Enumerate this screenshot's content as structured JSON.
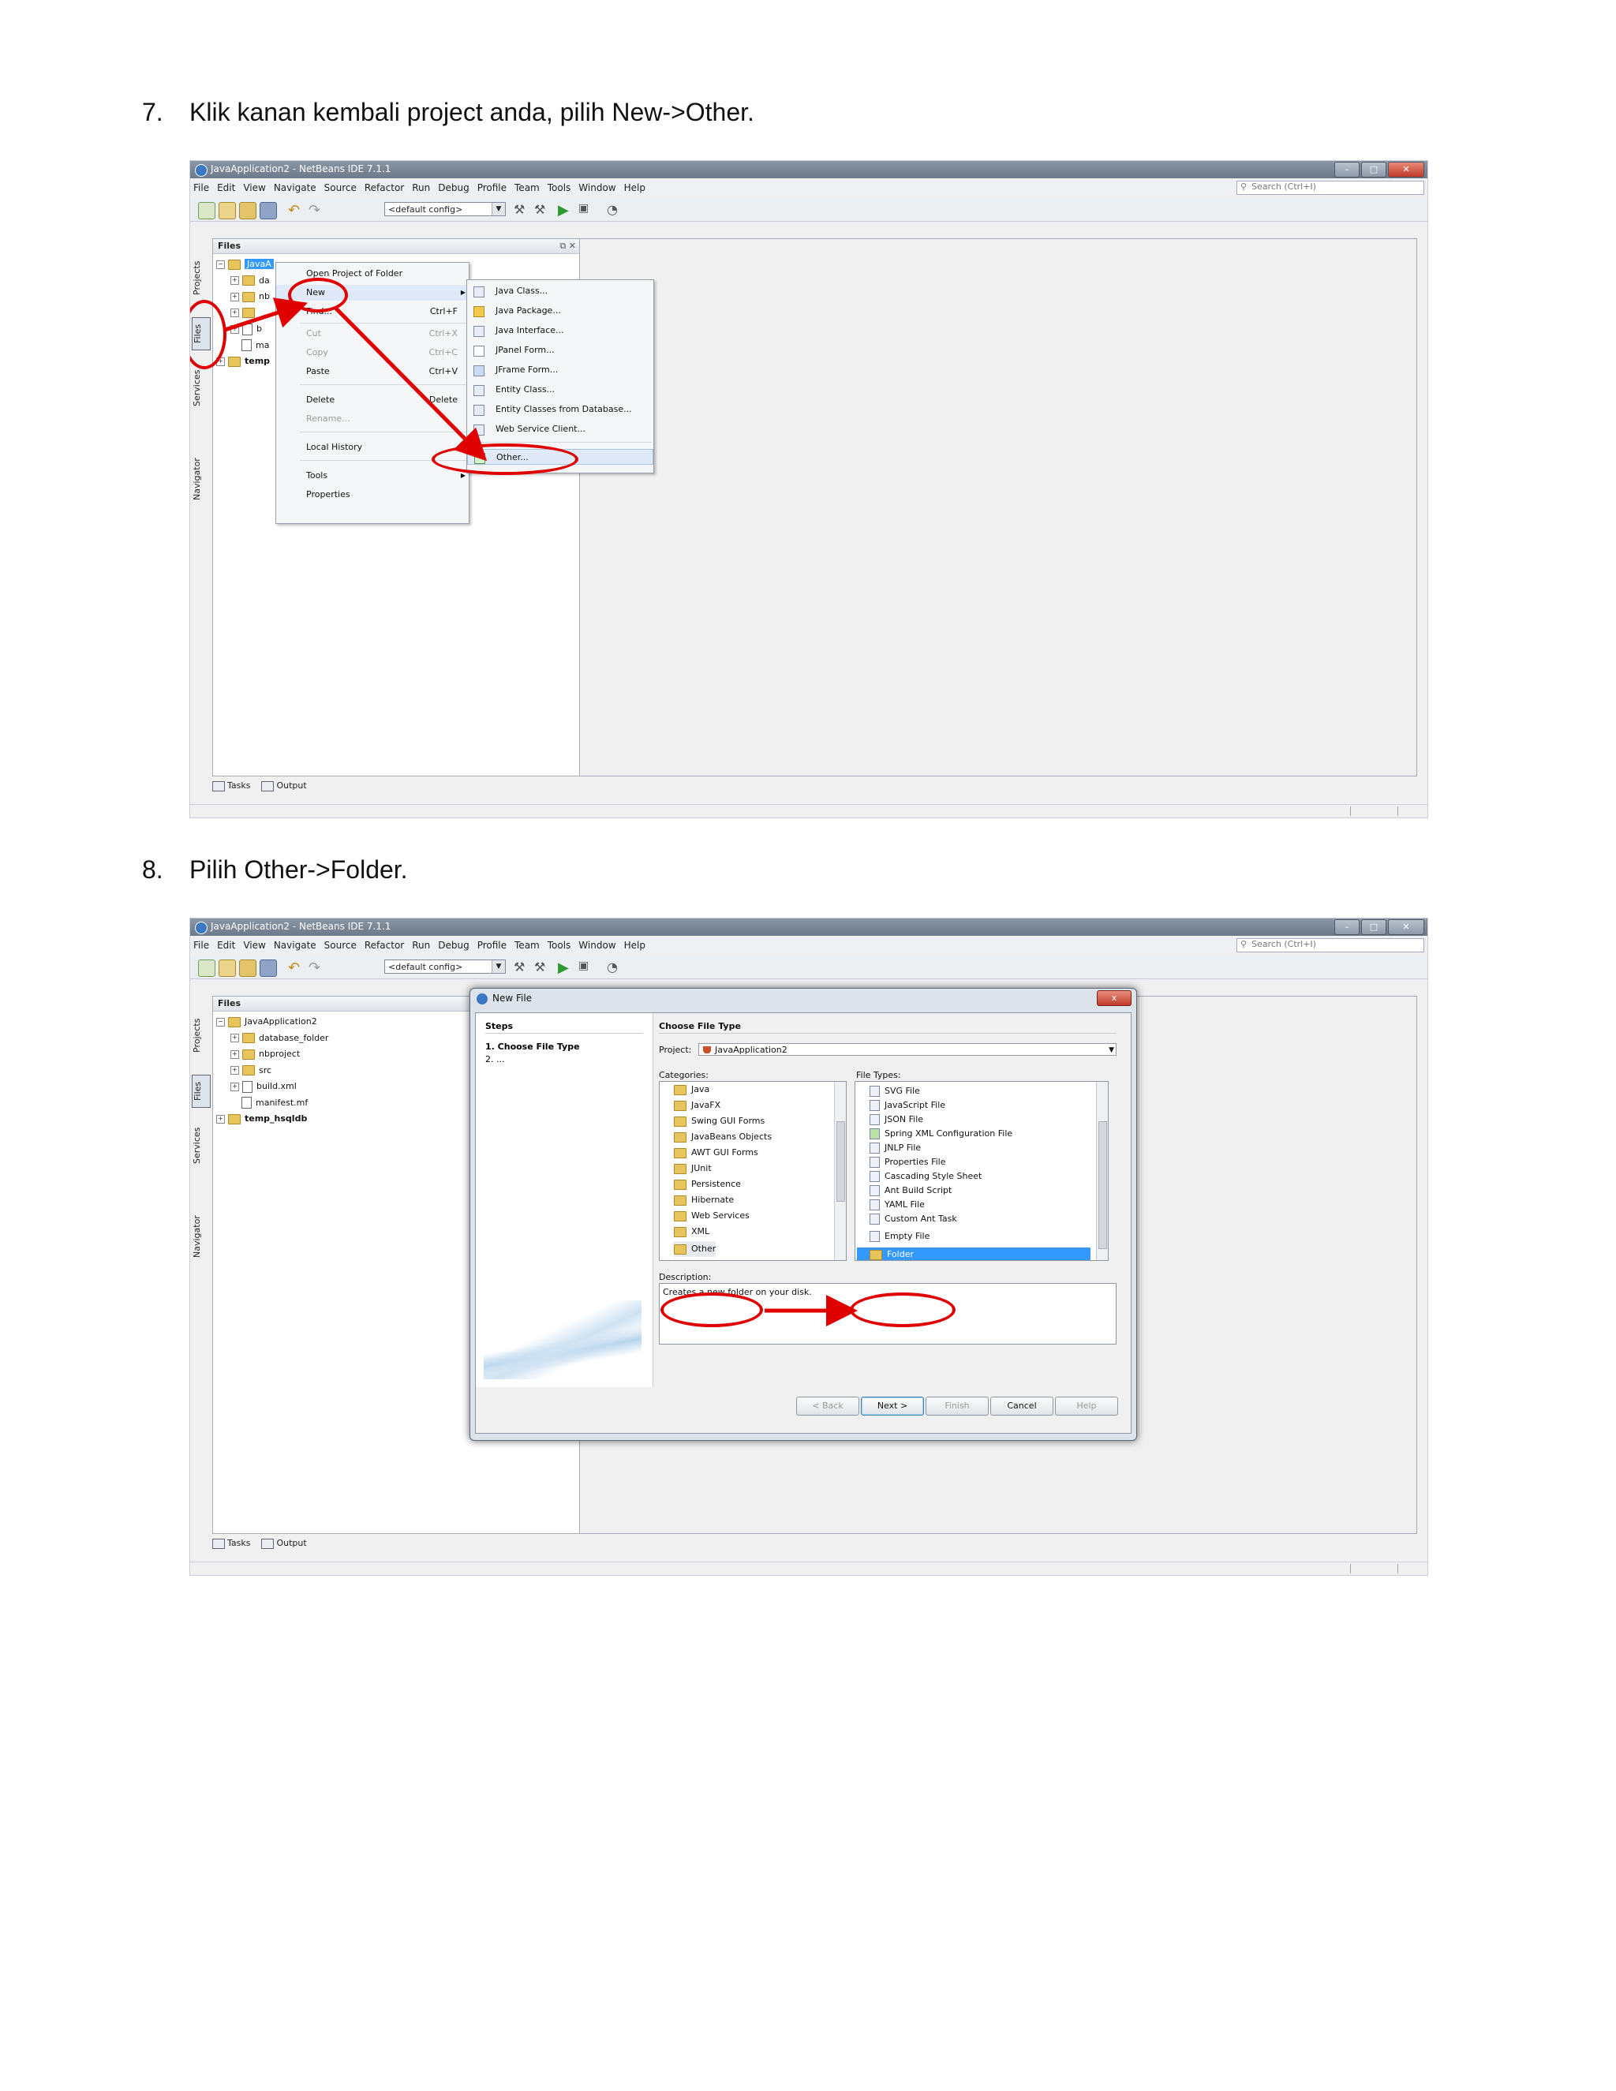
{
  "step7": {
    "number": "7.",
    "text": "Klik kanan kembali project anda, pilih New->Other."
  },
  "step8": {
    "number": "8.",
    "text": "Pilih Other->Folder."
  },
  "ide": {
    "title": "JavaApplication2 - NetBeans IDE 7.1.1",
    "menu": [
      "File",
      "Edit",
      "View",
      "Navigate",
      "Source",
      "Refactor",
      "Run",
      "Debug",
      "Profile",
      "Team",
      "Tools",
      "Window",
      "Help"
    ],
    "search_placeholder": "Search (Ctrl+I)",
    "config": "<default config>",
    "side_tabs": [
      "Projects",
      "Files",
      "Services",
      "Navigator"
    ],
    "panel_title": "Files",
    "bottom_tabs": [
      "Tasks",
      "Output"
    ]
  },
  "shot1": {
    "tree": [
      {
        "toggle": "⊟",
        "label": "JavaA",
        "selected": true
      },
      {
        "toggle": "⊞",
        "label": "da"
      },
      {
        "toggle": "⊞",
        "label": "nb"
      },
      {
        "toggle": "⊞",
        "label": ""
      },
      {
        "toggle": "⊞",
        "label": "b"
      },
      {
        "toggle": "",
        "label": "ma"
      },
      {
        "toggle": "⊞",
        "label": "temp",
        "bold": true
      }
    ],
    "context_menu": [
      {
        "label": "Open Project of Folder",
        "shortcut": ""
      },
      {
        "label": "New",
        "shortcut": "",
        "submenu": true
      },
      {
        "label": "Find...",
        "shortcut": "Ctrl+F"
      },
      {
        "label": "Cut",
        "shortcut": "Ctrl+X",
        "disabled": true
      },
      {
        "label": "Copy",
        "shortcut": "Ctrl+C",
        "disabled": true
      },
      {
        "label": "Paste",
        "shortcut": "Ctrl+V"
      },
      {
        "label": "Delete",
        "shortcut": "Delete"
      },
      {
        "label": "Rename...",
        "shortcut": "",
        "disabled": true
      },
      {
        "label": "Local History",
        "shortcut": "",
        "submenu": true
      },
      {
        "label": "Tools",
        "shortcut": "",
        "submenu": true
      },
      {
        "label": "Properties",
        "shortcut": ""
      }
    ],
    "new_submenu": [
      "Java Class...",
      "Java Package...",
      "Java Interface...",
      "JPanel Form...",
      "JFrame Form...",
      "Entity Class...",
      "Entity Classes from Database...",
      "Web Service Client...",
      "Other..."
    ]
  },
  "shot2": {
    "tree": [
      {
        "toggle": "⊟",
        "label": "JavaApplication2",
        "level": 0
      },
      {
        "toggle": "⊞",
        "label": "database_folder",
        "level": 1
      },
      {
        "toggle": "⊞",
        "label": "nbproject",
        "level": 1
      },
      {
        "toggle": "⊞",
        "label": "src",
        "level": 1
      },
      {
        "toggle": "⊞",
        "label": "build.xml",
        "level": 1,
        "file": true
      },
      {
        "toggle": "",
        "label": "manifest.mf",
        "level": 1,
        "file": true
      },
      {
        "toggle": "⊞",
        "label": "temp_hsqldb",
        "level": 0,
        "bold": true
      }
    ],
    "dialog": {
      "title": "New File",
      "close": "x",
      "steps_header": "Steps",
      "step1": "1.    Choose File Type",
      "step2": "2.    ...",
      "pane_title": "Choose File Type",
      "project_label": "Project:",
      "project_value": "JavaApplication2",
      "categories_label": "Categories:",
      "file_types_label": "File Types:",
      "categories": [
        "Java",
        "JavaFX",
        "Swing GUI Forms",
        "JavaBeans Objects",
        "AWT GUI Forms",
        "JUnit",
        "Persistence",
        "Hibernate",
        "Web Services",
        "XML",
        "Other"
      ],
      "file_types": [
        "SVG File",
        "JavaScript File",
        "JSON File",
        "Spring XML Configuration File",
        "JNLP File",
        "Properties File",
        "Cascading Style Sheet",
        "Ant Build Script",
        "YAML File",
        "Custom Ant Task",
        "Empty File",
        "Folder"
      ],
      "description_label": "Description:",
      "description": "Creates a new folder on your disk.",
      "buttons": [
        "< Back",
        "Next >",
        "Finish",
        "Cancel",
        "Help"
      ]
    }
  }
}
